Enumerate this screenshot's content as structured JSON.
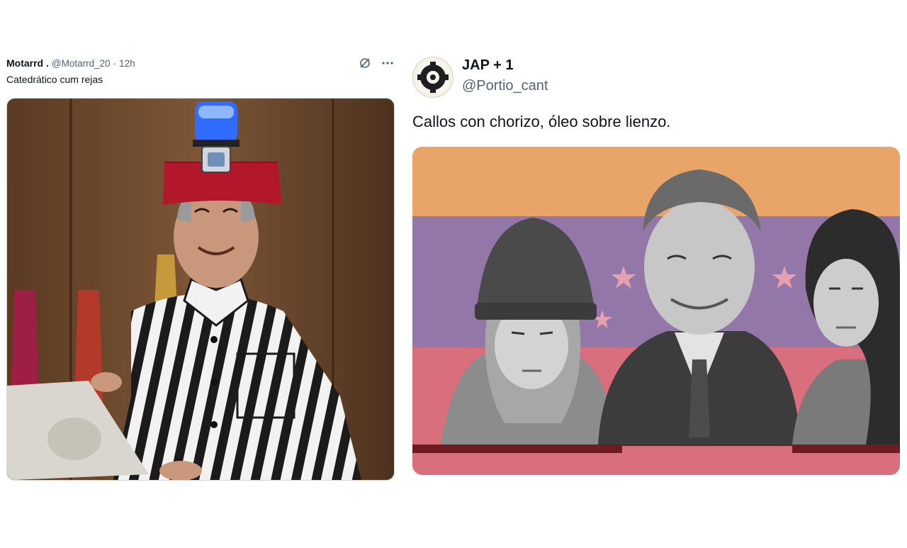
{
  "left_tweet": {
    "display_name": "Motarrd .",
    "handle": "@Motarrd_20",
    "separator": "·",
    "time": "12h",
    "text": "Catedrático cum rejas",
    "media_description": "prisoner-stripes-edited-photo",
    "icons": [
      "grok-icon",
      "more-options-icon"
    ],
    "colors": {
      "stripe_dark": "#1b1b1b",
      "stripe_light": "#f2f2f2",
      "fez": "#b3182a",
      "siren": "#2f6cff"
    }
  },
  "right_tweet": {
    "display_name": "JAP + 1",
    "handle": "@Portio_cant",
    "text": "Callos con chorizo, óleo sobre lienzo.",
    "avatar_icon": "emblem-icon",
    "colors": {
      "band_orange": "#e9a468",
      "band_purple": "#9377a9",
      "band_pink": "#d96e7c",
      "bar_dark": "#6e1b22",
      "star": "#e5a1b0"
    }
  }
}
